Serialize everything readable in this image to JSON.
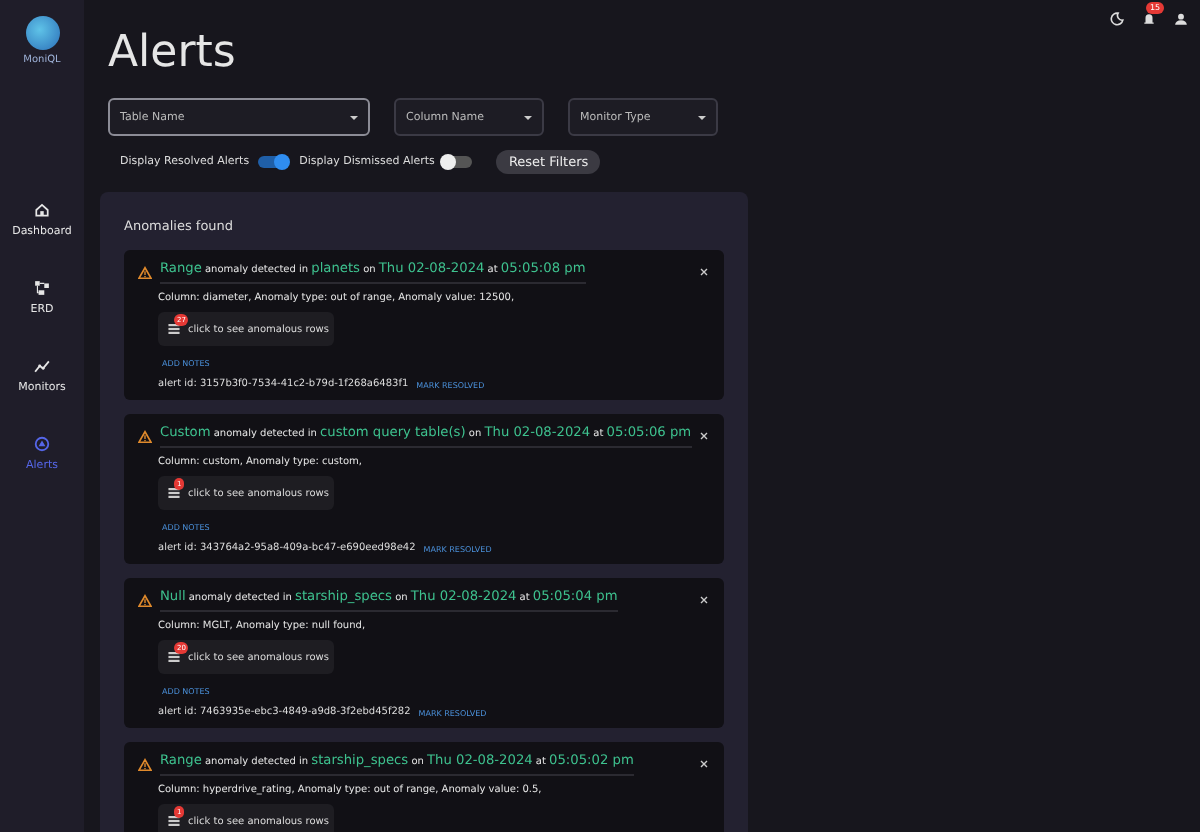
{
  "sidebar": {
    "logo_text": "MoniQL",
    "items": [
      {
        "label": "Dashboard",
        "selected": false
      },
      {
        "label": "ERD",
        "selected": false
      },
      {
        "label": "Monitors",
        "selected": false
      },
      {
        "label": "Alerts",
        "selected": true
      }
    ]
  },
  "topbar": {
    "notification_count": "15"
  },
  "page_title": "Alerts",
  "filters": [
    {
      "placeholder": "Table Name",
      "focused": true
    },
    {
      "placeholder": "Column Name",
      "focused": false
    },
    {
      "placeholder": "Monitor Type",
      "focused": false
    }
  ],
  "toggles": [
    {
      "label": "Display Resolved Alerts",
      "on": true
    },
    {
      "label": "Display Dismissed Alerts",
      "on": false
    }
  ],
  "reset_button": "Reset Filters",
  "panel_title": "Anomalies found",
  "alerts": [
    {
      "title": [
        {
          "text": "Range",
          "highlight": true
        },
        {
          "text": " anomaly detected in ",
          "highlight": false
        },
        {
          "text": "planets",
          "highlight": true
        },
        {
          "text": " on ",
          "highlight": false
        },
        {
          "text": "Thu 02-08-2024",
          "highlight": true
        },
        {
          "text": " at ",
          "highlight": false
        },
        {
          "text": "05:05:08 pm",
          "highlight": true
        }
      ],
      "details": "Column: diameter, Anomaly type: out of range, Anomaly value: 12500,",
      "rows_count": "27",
      "rows_button": "click to see anomalous rows",
      "notes_link": "ADD NOTES",
      "alert_id": "alert id: 3157b3f0-7534-41c2-b79d-1f268a6483f1",
      "resolve_link": "MARK RESOLVED"
    },
    {
      "title": [
        {
          "text": "Custom",
          "highlight": true
        },
        {
          "text": " anomaly detected in ",
          "highlight": false
        },
        {
          "text": "custom query table(s)",
          "highlight": true
        },
        {
          "text": " on ",
          "highlight": false
        },
        {
          "text": "Thu 02-08-2024",
          "highlight": true
        },
        {
          "text": " at ",
          "highlight": false
        },
        {
          "text": "05:05:06 pm",
          "highlight": true
        }
      ],
      "details": "Column: custom, Anomaly type: custom,",
      "rows_count": "1",
      "rows_button": "click to see anomalous rows",
      "notes_link": "ADD NOTES",
      "alert_id": "alert id: 343764a2-95a8-409a-bc47-e690eed98e42",
      "resolve_link": "MARK RESOLVED"
    },
    {
      "title": [
        {
          "text": "Null",
          "highlight": true
        },
        {
          "text": " anomaly detected in ",
          "highlight": false
        },
        {
          "text": "starship_specs",
          "highlight": true
        },
        {
          "text": " on ",
          "highlight": false
        },
        {
          "text": "Thu 02-08-2024",
          "highlight": true
        },
        {
          "text": " at ",
          "highlight": false
        },
        {
          "text": "05:05:04 pm",
          "highlight": true
        }
      ],
      "details": "Column: MGLT, Anomaly type: null found,",
      "rows_count": "20",
      "rows_button": "click to see anomalous rows",
      "notes_link": "ADD NOTES",
      "alert_id": "alert id: 7463935e-ebc3-4849-a9d8-3f2ebd45f282",
      "resolve_link": "MARK RESOLVED"
    },
    {
      "title": [
        {
          "text": "Range",
          "highlight": true
        },
        {
          "text": " anomaly detected in ",
          "highlight": false
        },
        {
          "text": "starship_specs",
          "highlight": true
        },
        {
          "text": " on ",
          "highlight": false
        },
        {
          "text": "Thu 02-08-2024",
          "highlight": true
        },
        {
          "text": " at ",
          "highlight": false
        },
        {
          "text": "05:05:02 pm",
          "highlight": true
        }
      ],
      "details": "Column: hyperdrive_rating, Anomaly type: out of range, Anomaly value: 0.5,",
      "rows_count": "1",
      "rows_button": "click to see anomalous rows"
    }
  ]
}
